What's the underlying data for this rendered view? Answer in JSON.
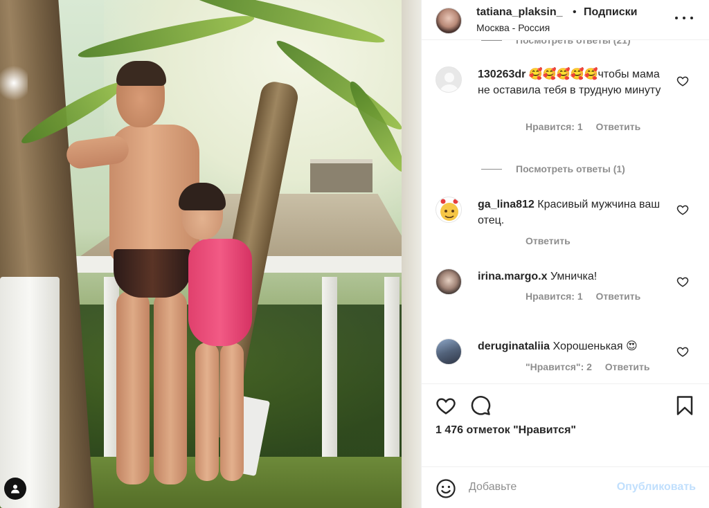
{
  "post": {
    "username": "tatiana_plaksin_",
    "dot": "•",
    "follow_label": "Подписки",
    "location": "Москва - Россия"
  },
  "comments": {
    "top_view_replies": "Посмотреть ответы (21)",
    "items": [
      {
        "username": "130263dr",
        "text": "🥰🥰🥰🥰🥰чтобы мама не оставила тебя в трудную минуту",
        "likes_label": "Нравится: 1",
        "reply_label": "Ответить",
        "view_replies": "Посмотреть ответы (1)"
      },
      {
        "username": "ga_lina812",
        "text": "Красивый мужчина ваш отец.",
        "reply_label": "Ответить"
      },
      {
        "username": "irina.margo.x",
        "text": "Умничка!",
        "likes_label": "Нравится: 1",
        "reply_label": "Ответить"
      },
      {
        "username": "deruginataliia",
        "text": "Хорошенькая 😍",
        "likes_label": "\"Нравится\": 2",
        "reply_label": "Ответить"
      }
    ]
  },
  "actions": {
    "likes_count": "1 476 отметок \"Нравится\""
  },
  "add_comment": {
    "placeholder": "Добавьте",
    "publish_label": "Опубликовать"
  },
  "colors": {
    "text": "#262626",
    "secondary": "#8e8e8e",
    "publish_disabled": "#c0dffd",
    "border": "#efefef"
  },
  "icons": {
    "like": "heart-icon",
    "comment": "comment-bubble-icon",
    "save": "bookmark-icon",
    "emoji": "smiley-icon",
    "more": "more-dots-icon",
    "tag": "user-tag-icon"
  }
}
